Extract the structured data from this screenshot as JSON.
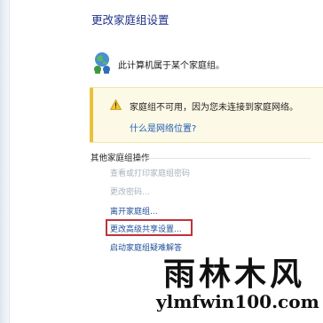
{
  "window": {
    "title": "更改家庭组设置"
  },
  "status": {
    "text": "此计算机属于某个家庭组。",
    "icon": "homegroup-icon"
  },
  "warning": {
    "icon": "warning-icon",
    "message": "家庭组不可用，因为您未连接到家庭网络。",
    "link_label": "什么是网络位置?",
    "accent_color": "#e9c13a"
  },
  "other_actions": {
    "header": "其他家庭组操作",
    "items": [
      {
        "label": "查看或打印家庭组密码",
        "enabled": false
      },
      {
        "label": "更改密码...",
        "enabled": false
      },
      {
        "label": "离开家庭组...",
        "enabled": true
      },
      {
        "label": "更改高级共享设置...",
        "enabled": true,
        "highlighted": true
      },
      {
        "label": "启动家庭组疑难解答",
        "enabled": true
      }
    ],
    "highlight_color": "#c0333a"
  },
  "watermark": {
    "title": "雨林木风",
    "url": "ylmfwin100.com"
  }
}
